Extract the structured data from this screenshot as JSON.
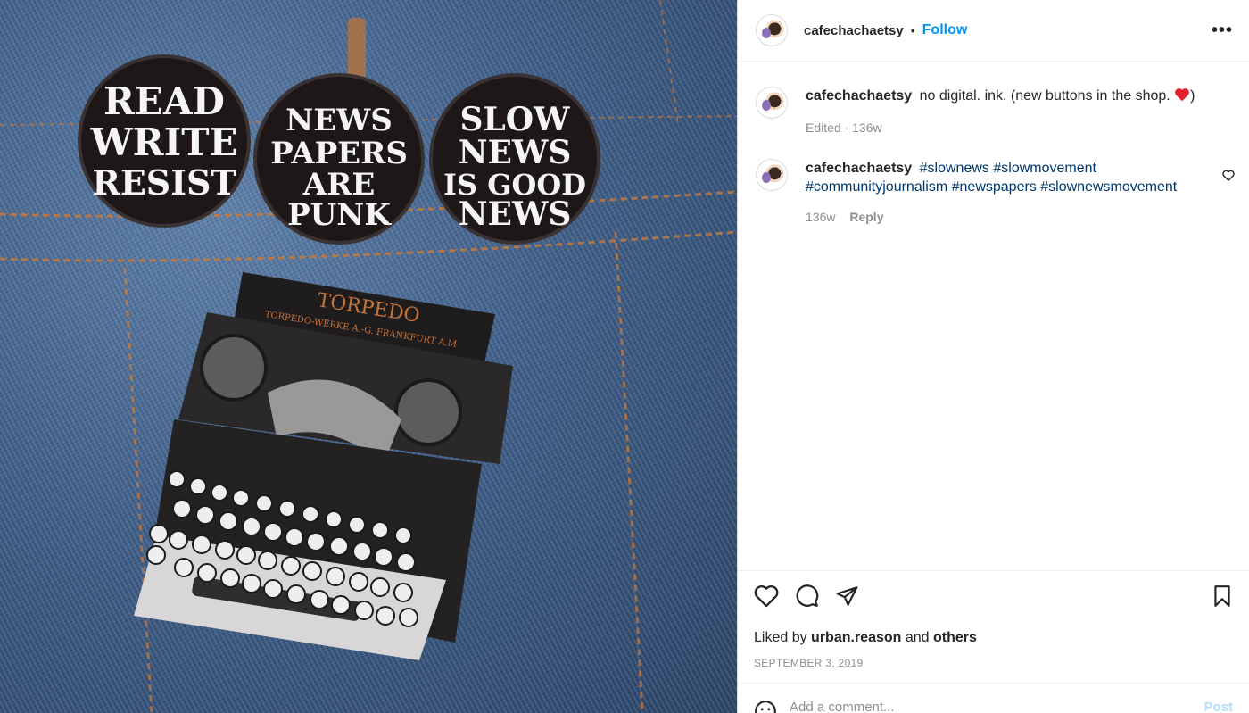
{
  "header": {
    "username": "cafechachaetsy",
    "separator": "•",
    "follow_label": "Follow",
    "more_label": "•••"
  },
  "caption": {
    "username": "cafechachaetsy",
    "text": "no digital. ink. (new buttons in the shop.",
    "text_end": ")",
    "meta": "Edited · 136w"
  },
  "comment": {
    "username": "cafechachaetsy",
    "tags": [
      "#slownews",
      "#slowmovement",
      "#communityjournalism",
      "#newspapers",
      "#slownewsmovement"
    ],
    "time": "136w",
    "reply_label": "Reply"
  },
  "photo": {
    "buttons": [
      {
        "lines": [
          "READ",
          "WRITE",
          "RESIST"
        ]
      },
      {
        "lines": [
          "NEWS",
          "PAPERS",
          "ARE",
          "PUNK"
        ]
      },
      {
        "lines": [
          "SLOW",
          "NEWS",
          "IS GOOD",
          "NEWS"
        ]
      }
    ],
    "typewriter_brand": "TORPEDO",
    "typewriter_maker": "TORPEDO-WERKE A.-G. FRANKFURT A.M"
  },
  "actions": {
    "like_icon": "heart-icon",
    "comment_icon": "comment-icon",
    "share_icon": "share-icon",
    "save_icon": "bookmark-icon"
  },
  "likes": {
    "prefix": "Liked by",
    "user": "urban.reason",
    "middle": "and",
    "others": "others"
  },
  "date": "September 3, 2019",
  "add_comment": {
    "placeholder": "Add a comment...",
    "post_label": "Post"
  },
  "colors": {
    "accent": "#0095f6",
    "hashtag": "#00376b",
    "muted": "#8e8e8e",
    "heart_red": "#ed4956"
  }
}
